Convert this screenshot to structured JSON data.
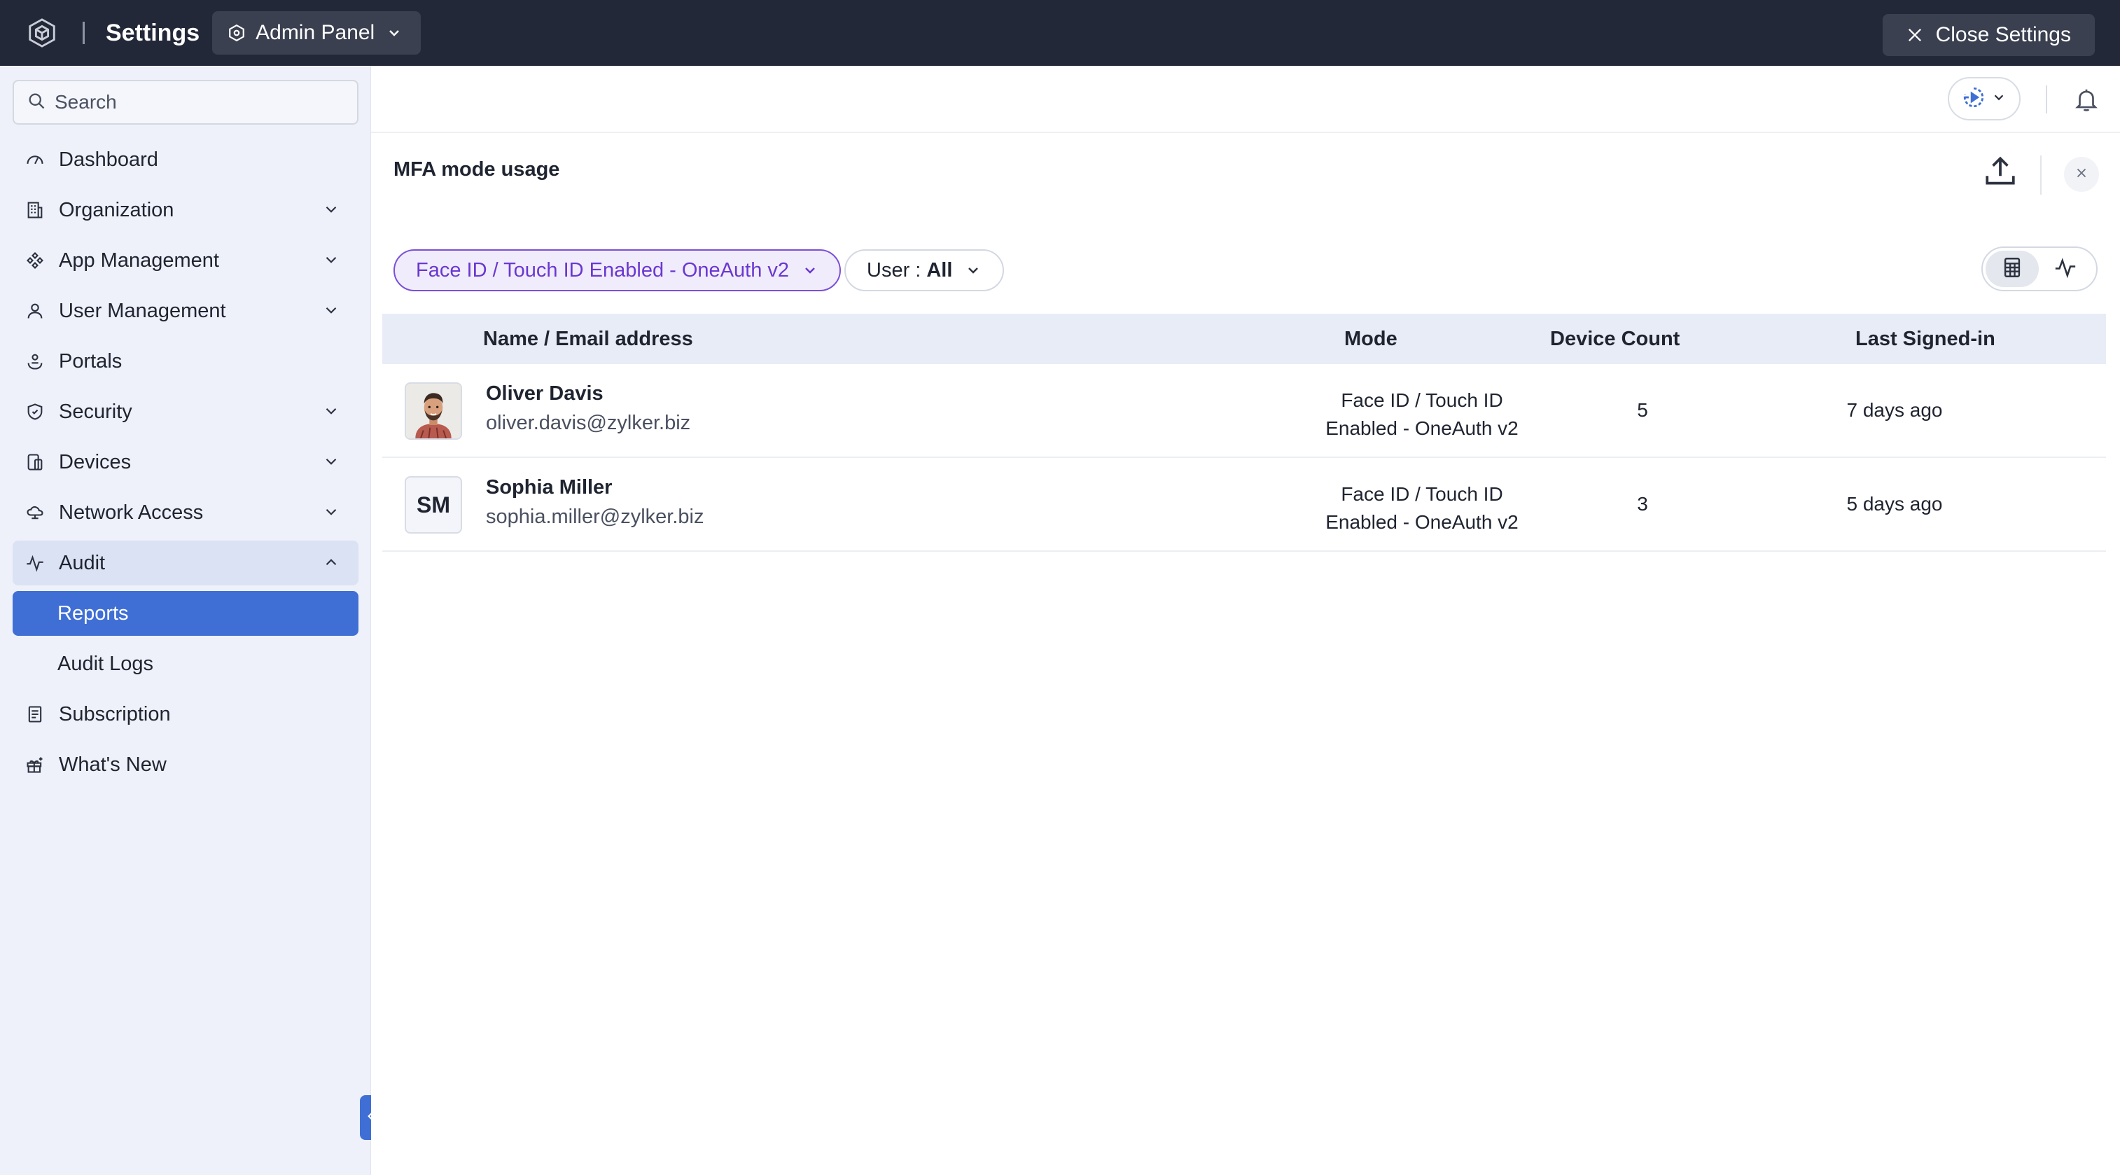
{
  "topbar": {
    "title": "Settings",
    "context": "Admin Panel",
    "close_label": "Close Settings"
  },
  "sidebar": {
    "search_placeholder": "Search",
    "items": [
      {
        "label": "Dashboard",
        "icon": "dashboard-icon",
        "expandable": false
      },
      {
        "label": "Organization",
        "icon": "organization-icon",
        "expandable": true
      },
      {
        "label": "App Management",
        "icon": "app-management-icon",
        "expandable": true
      },
      {
        "label": "User Management",
        "icon": "user-icon",
        "expandable": true
      },
      {
        "label": "Portals",
        "icon": "portals-icon",
        "expandable": false
      },
      {
        "label": "Security",
        "icon": "shield-icon",
        "expandable": true
      },
      {
        "label": "Devices",
        "icon": "devices-icon",
        "expandable": true
      },
      {
        "label": "Network Access",
        "icon": "cloud-network-icon",
        "expandable": true
      },
      {
        "label": "Audit",
        "icon": "activity-icon",
        "expandable": true,
        "open": true
      },
      {
        "label": "Reports",
        "sub": true,
        "active": true
      },
      {
        "label": "Audit Logs",
        "sub": true
      },
      {
        "label": "Subscription",
        "icon": "subscription-icon",
        "expandable": false
      },
      {
        "label": "What's New",
        "icon": "gift-icon",
        "expandable": false
      }
    ]
  },
  "report": {
    "title": "MFA mode usage",
    "filter_mode": "Face ID / Touch ID Enabled - OneAuth v2",
    "filter_user_label": "User :",
    "filter_user_value": "All"
  },
  "table": {
    "columns": [
      "Name / Email address",
      "Mode",
      "Device Count",
      "Last Signed-in"
    ],
    "rows": [
      {
        "name": "Oliver Davis",
        "email": "oliver.davis@zylker.biz",
        "avatar": "photo",
        "mode_line1": "Face ID / Touch ID",
        "mode_line2": "Enabled - OneAuth v2",
        "device_count": "5",
        "last_signed_in": "7 days ago"
      },
      {
        "name": "Sophia Miller",
        "email": "sophia.miller@zylker.biz",
        "avatar": "SM",
        "mode_line1": "Face ID / Touch ID",
        "mode_line2": "Enabled - OneAuth v2",
        "device_count": "3",
        "last_signed_in": "5 days ago"
      }
    ]
  },
  "colors": {
    "topbar": "#222838",
    "sidebar": "#eef1f9",
    "active": "#3f6fd5",
    "filter_purple": "#7b4fd6"
  }
}
